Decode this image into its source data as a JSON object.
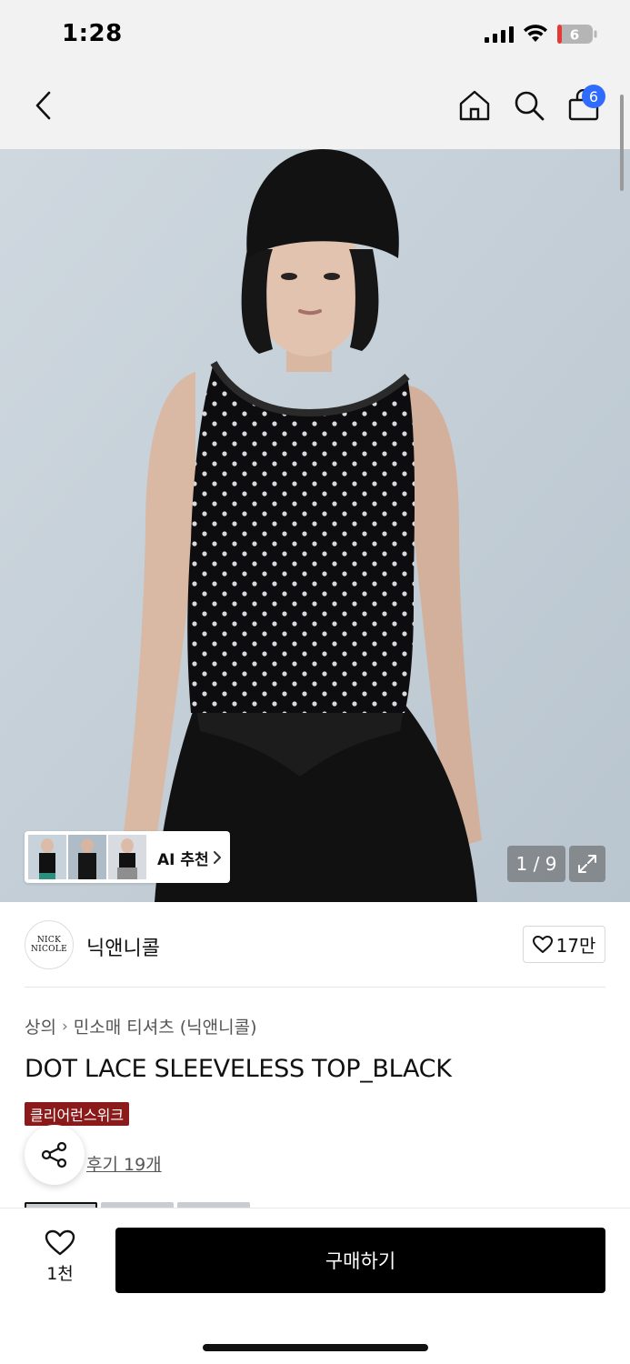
{
  "status_bar": {
    "time": "1:28",
    "battery_level": "6"
  },
  "nav": {
    "back_icon": "chevron-left-icon",
    "home_icon": "home-icon",
    "search_icon": "search-icon",
    "bag_icon": "shopping-bag-icon",
    "bag_count": "6"
  },
  "gallery": {
    "ai_label": "AI 추천",
    "page_indicator": "1 / 9",
    "current_page": 1,
    "total_pages": 9
  },
  "brand": {
    "logo_line1": "NICK",
    "logo_line2": "NICOLE",
    "name": "닉앤니콜",
    "like_count": "17만"
  },
  "product": {
    "breadcrumb": [
      "상의",
      "민소매 티셔츠 (닉앤니콜)"
    ],
    "title": "DOT LACE SLEEVELESS TOP_BLACK",
    "promo_badge": "클리어런스위크",
    "review_link": "후기 19개"
  },
  "bottom_bar": {
    "wish_count": "1천",
    "buy_label": "구매하기"
  },
  "colors": {
    "accent_badge": "#2f6bff",
    "promo_red": "#8b1a1a",
    "buy_button": "#000000",
    "background_bar": "#f2f2f2"
  }
}
